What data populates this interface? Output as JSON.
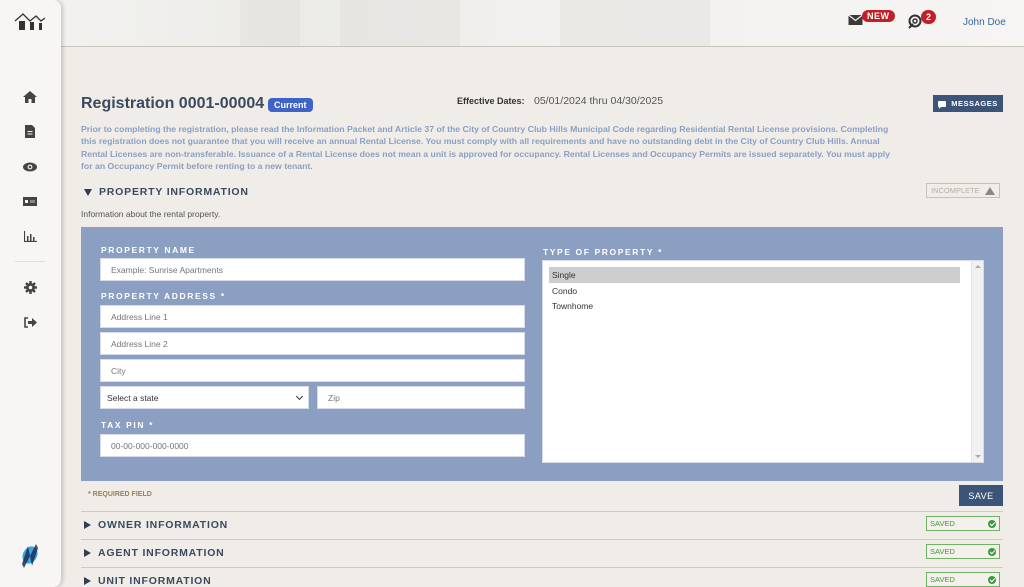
{
  "header": {
    "notifications": {
      "mail_badge": "NEW",
      "sync_badge": "2"
    },
    "user_name": "John Doe"
  },
  "sidebar": {
    "items": [
      {
        "icon": "home-icon",
        "label": "Home"
      },
      {
        "icon": "document-icon",
        "label": "Documents"
      },
      {
        "icon": "eye-icon",
        "label": "View"
      },
      {
        "icon": "money-icon",
        "label": "Payments"
      },
      {
        "icon": "chart-icon",
        "label": "Reports"
      },
      {
        "icon": "gear-icon",
        "label": "Settings"
      },
      {
        "icon": "sign-out-icon",
        "label": "Sign Out"
      }
    ]
  },
  "registration": {
    "title": "Registration 0001-00004",
    "status_badge": "Current",
    "effective_dates_label": "Effective Dates:",
    "effective_dates_value": "05/01/2024 thru 04/30/2025",
    "messages_button": "MESSAGES",
    "intro_text": "Prior to completing the registration, please read the Information Packet and Article 37 of the City of Country Club Hills Municipal Code regarding Residential Rental License provisions. Completing this registration does not guarantee that you will receive an annual Rental License. You must comply with all requirements and have no outstanding debt in the City of Country Club Hills. Annual Rental Licenses are non-transferable. Issuance of a Rental License does not mean a unit is approved for occupancy. Rental Licenses and Occupancy Permits are issued separately. You must apply for an Occupancy Permit before renting to a new tenant."
  },
  "property_section": {
    "title": "PROPERTY INFORMATION",
    "status": "INCOMPLETE",
    "description": "Information about the rental property.",
    "fields": {
      "property_name_label": "PROPERTY NAME",
      "property_name_placeholder": "Example: Sunrise Apartments",
      "property_address_label": "PROPERTY ADDRESS",
      "address1_placeholder": "Address Line 1",
      "address2_placeholder": "Address Line 2",
      "city_placeholder": "City",
      "state_selected": "Select a state",
      "zip_placeholder": "Zip",
      "tax_pin_label": "TAX PIN",
      "tax_pin_placeholder": "00-00-000-000-0000",
      "type_label": "TYPE OF PROPERTY",
      "type_options": [
        "Single",
        "Condo",
        "Townhome"
      ],
      "type_selected": "Single",
      "required_star": "*"
    },
    "required_note": "* REQUIRED FIELD",
    "save_button": "SAVE"
  },
  "sections": [
    {
      "title": "OWNER INFORMATION",
      "status": "SAVED"
    },
    {
      "title": "AGENT INFORMATION",
      "status": "SAVED"
    },
    {
      "title": "UNIT INFORMATION",
      "status": "SAVED"
    }
  ],
  "colors": {
    "accent": "#3d5479",
    "panel": "#8a9fc1",
    "badge_red": "#c0202a",
    "current_badge": "#3f63c8",
    "saved_green": "#3e9a3a"
  }
}
